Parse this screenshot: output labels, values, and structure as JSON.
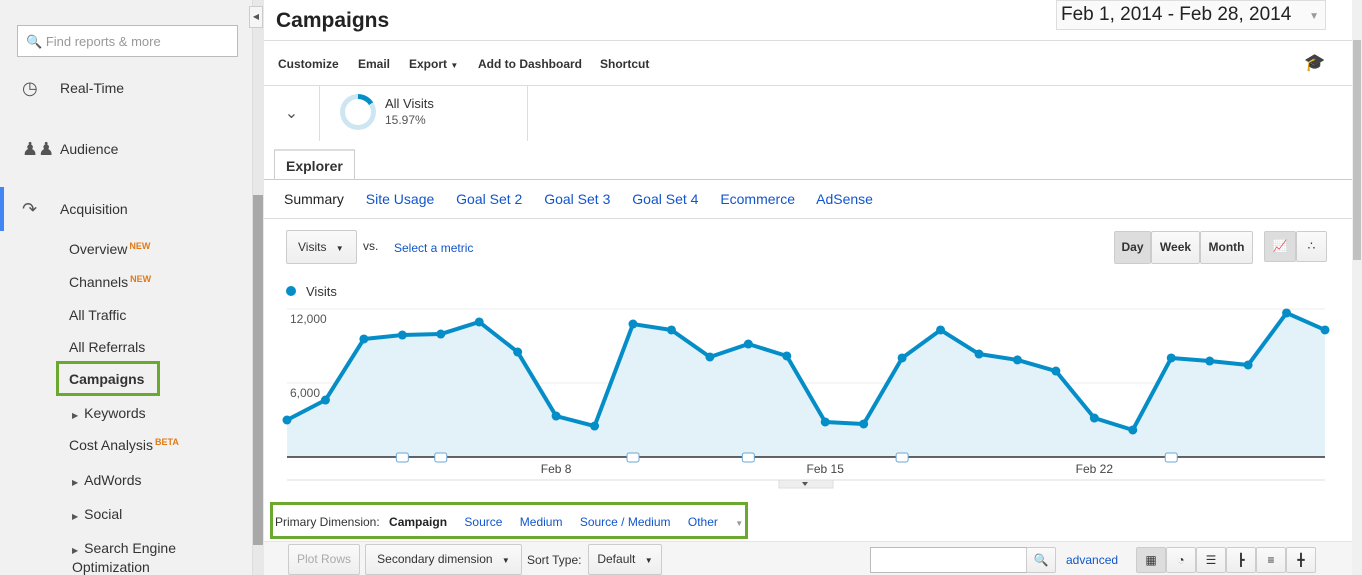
{
  "sidebar": {
    "search_placeholder": "Find reports & more",
    "items": [
      {
        "label": "Real-Time",
        "icon": "clock-icon"
      },
      {
        "label": "Audience",
        "icon": "people-icon"
      },
      {
        "label": "Acquisition",
        "icon": "acquisition-arrows-icon"
      }
    ],
    "acquisition": [
      {
        "label": "Overview",
        "badge": "NEW"
      },
      {
        "label": "Channels",
        "badge": "NEW"
      },
      {
        "label": "All Traffic"
      },
      {
        "label": "All Referrals"
      },
      {
        "label": "Campaigns",
        "active": true
      },
      {
        "label": "Keywords"
      },
      {
        "label": "Cost Analysis",
        "badge": "BETA"
      },
      {
        "label": "AdWords"
      },
      {
        "label": "Social"
      },
      {
        "label": "Search Engine Optimization"
      }
    ]
  },
  "header": {
    "title": "Campaigns",
    "date_range": "Feb 1, 2014 - Feb 28, 2014"
  },
  "toolbar": {
    "customize": "Customize",
    "email": "Email",
    "export": "Export",
    "add_dashboard": "Add to Dashboard",
    "shortcut": "Shortcut"
  },
  "segment": {
    "name": "All Visits",
    "percent": "15.97%",
    "percent_value": 15.97
  },
  "explorer": {
    "tab": "Explorer",
    "subtabs": [
      "Summary",
      "Site Usage",
      "Goal Set 2",
      "Goal Set 3",
      "Goal Set 4",
      "Ecommerce",
      "AdSense"
    ]
  },
  "chart_controls": {
    "metric": "Visits",
    "vs": "vs.",
    "select_metric": "Select a metric",
    "day": "Day",
    "week": "Week",
    "month": "Month"
  },
  "chart_data": {
    "type": "area",
    "legend": "Visits",
    "color": "#058dc7",
    "x": [
      "Feb 1",
      "Feb 2",
      "Feb 3",
      "Feb 4",
      "Feb 5",
      "Feb 6",
      "Feb 7",
      "Feb 8",
      "Feb 9",
      "Feb 10",
      "Feb 11",
      "Feb 12",
      "Feb 13",
      "Feb 14",
      "Feb 15",
      "Feb 16",
      "Feb 17",
      "Feb 18",
      "Feb 19",
      "Feb 20",
      "Feb 21",
      "Feb 22",
      "Feb 23",
      "Feb 24",
      "Feb 25",
      "Feb 26",
      "Feb 27",
      "Feb 28"
    ],
    "values": [
      3000,
      4620,
      9570,
      9890,
      9970,
      10950,
      8510,
      3320,
      2510,
      10780,
      10300,
      8110,
      9160,
      8190,
      2840,
      2680,
      8030,
      10300,
      8350,
      7870,
      6970,
      3160,
      2190,
      8030,
      7780,
      7460,
      11680,
      10300
    ],
    "yticks": [
      {
        "value": 6000,
        "label": "6,000"
      },
      {
        "value": 12000,
        "label": "12,000"
      }
    ],
    "xticks": [
      {
        "index": 7,
        "label": "Feb 8"
      },
      {
        "index": 14,
        "label": "Feb 15"
      },
      {
        "index": 21,
        "label": "Feb 22"
      }
    ],
    "annotations_at": [
      3,
      4,
      9,
      12,
      16,
      23
    ],
    "ylim": [
      0,
      12000
    ]
  },
  "primary_dimension": {
    "label": "Primary Dimension:",
    "options": [
      "Campaign",
      "Source",
      "Medium",
      "Source / Medium",
      "Other"
    ]
  },
  "table_controls": {
    "plot_rows": "Plot Rows",
    "secondary": "Secondary dimension",
    "sort_label": "Sort Type:",
    "sort_value": "Default",
    "advanced": "advanced"
  }
}
